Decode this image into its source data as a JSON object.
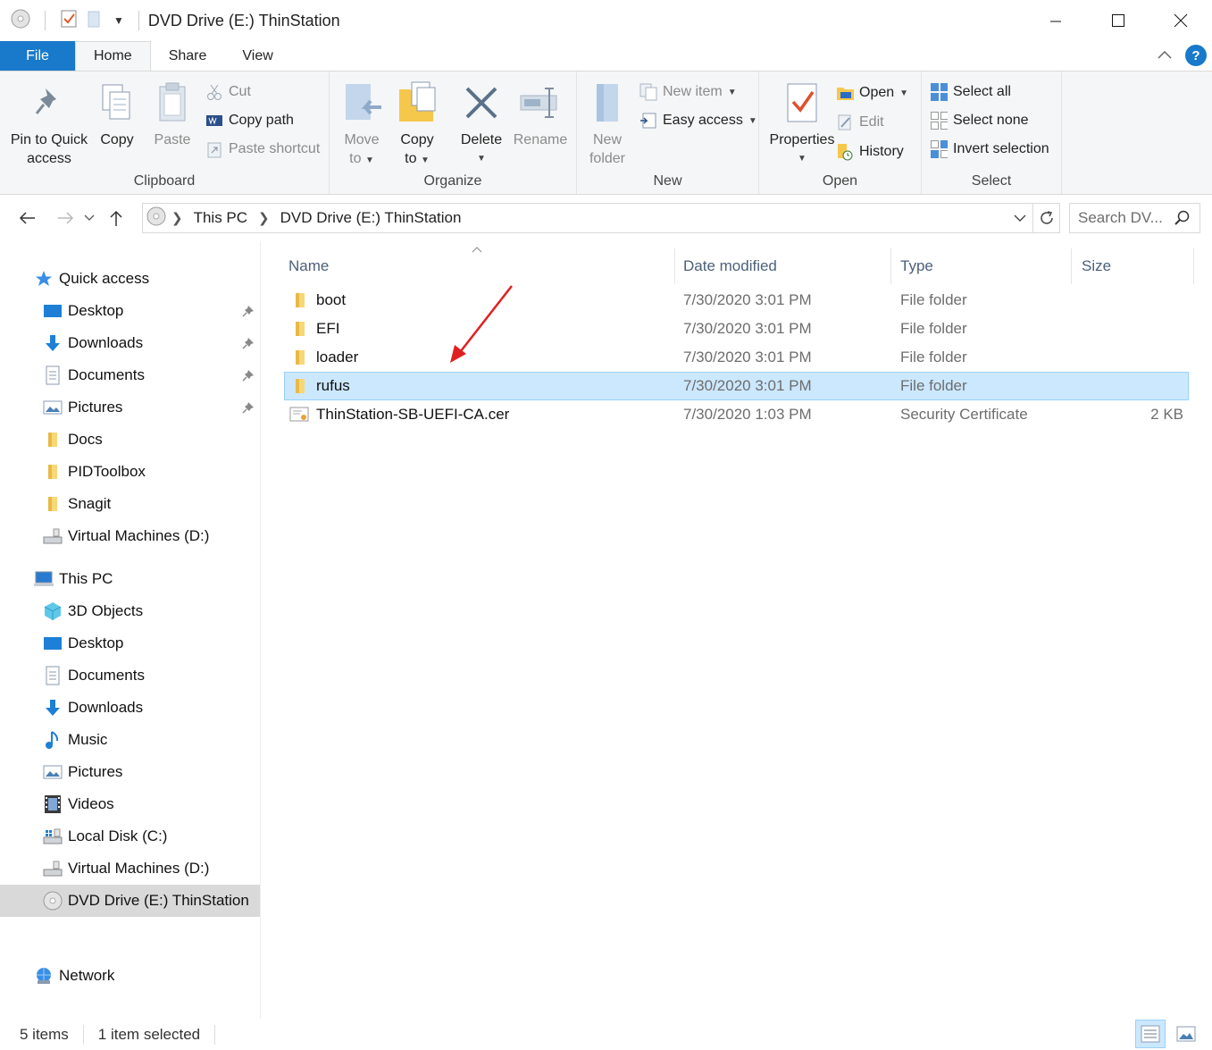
{
  "window": {
    "title": "DVD Drive (E:) ThinStation"
  },
  "tabs": {
    "file": "File",
    "home": "Home",
    "share": "Share",
    "view": "View"
  },
  "ribbon": {
    "clipboard": {
      "label": "Clipboard",
      "pin_l1": "Pin to Quick",
      "pin_l2": "access",
      "copy": "Copy",
      "paste": "Paste",
      "cut": "Cut",
      "copy_path": "Copy path",
      "paste_shortcut": "Paste shortcut"
    },
    "organize": {
      "label": "Organize",
      "move_l1": "Move",
      "move_l2": "to",
      "copy_l1": "Copy",
      "copy_l2": "to",
      "delete": "Delete",
      "rename": "Rename"
    },
    "new": {
      "label": "New",
      "folder_l1": "New",
      "folder_l2": "folder",
      "new_item": "New item",
      "easy_access": "Easy access"
    },
    "open": {
      "label": "Open",
      "properties": "Properties",
      "open": "Open",
      "edit": "Edit",
      "history": "History"
    },
    "select": {
      "label": "Select",
      "select_all": "Select all",
      "select_none": "Select none",
      "invert": "Invert selection"
    }
  },
  "address": {
    "seg1": "This PC",
    "seg2": "DVD Drive (E:) ThinStation",
    "search_placeholder": "Search DV..."
  },
  "nav": {
    "quick_access": "Quick access",
    "qa_desktop": "Desktop",
    "qa_downloads": "Downloads",
    "qa_documents": "Documents",
    "qa_pictures": "Pictures",
    "qa_docs": "Docs",
    "qa_pidtoolbox": "PIDToolbox",
    "qa_snagit": "Snagit",
    "qa_vm": "Virtual Machines (D:)",
    "this_pc": "This PC",
    "pc_3d": "3D Objects",
    "pc_desktop": "Desktop",
    "pc_documents": "Documents",
    "pc_downloads": "Downloads",
    "pc_music": "Music",
    "pc_pictures": "Pictures",
    "pc_videos": "Videos",
    "pc_c": "Local Disk (C:)",
    "pc_d": "Virtual Machines (D:)",
    "pc_e": "DVD Drive (E:) ThinStation",
    "network": "Network"
  },
  "columns": {
    "name": "Name",
    "date": "Date modified",
    "type": "Type",
    "size": "Size"
  },
  "files": [
    {
      "name": "boot",
      "date": "7/30/2020 3:01 PM",
      "type": "File folder",
      "size": ""
    },
    {
      "name": "EFI",
      "date": "7/30/2020 3:01 PM",
      "type": "File folder",
      "size": ""
    },
    {
      "name": "loader",
      "date": "7/30/2020 3:01 PM",
      "type": "File folder",
      "size": ""
    },
    {
      "name": "rufus",
      "date": "7/30/2020 3:01 PM",
      "type": "File folder",
      "size": ""
    },
    {
      "name": "ThinStation-SB-UEFI-CA.cer",
      "date": "7/30/2020 1:03 PM",
      "type": "Security Certificate",
      "size": "2 KB"
    }
  ],
  "status": {
    "count": "5 items",
    "selected": "1 item selected"
  },
  "colors": {
    "accent": "#1979ca",
    "selection": "#cce8ff",
    "folder": "#f8d775",
    "annotation_arrow": "#e02020"
  }
}
